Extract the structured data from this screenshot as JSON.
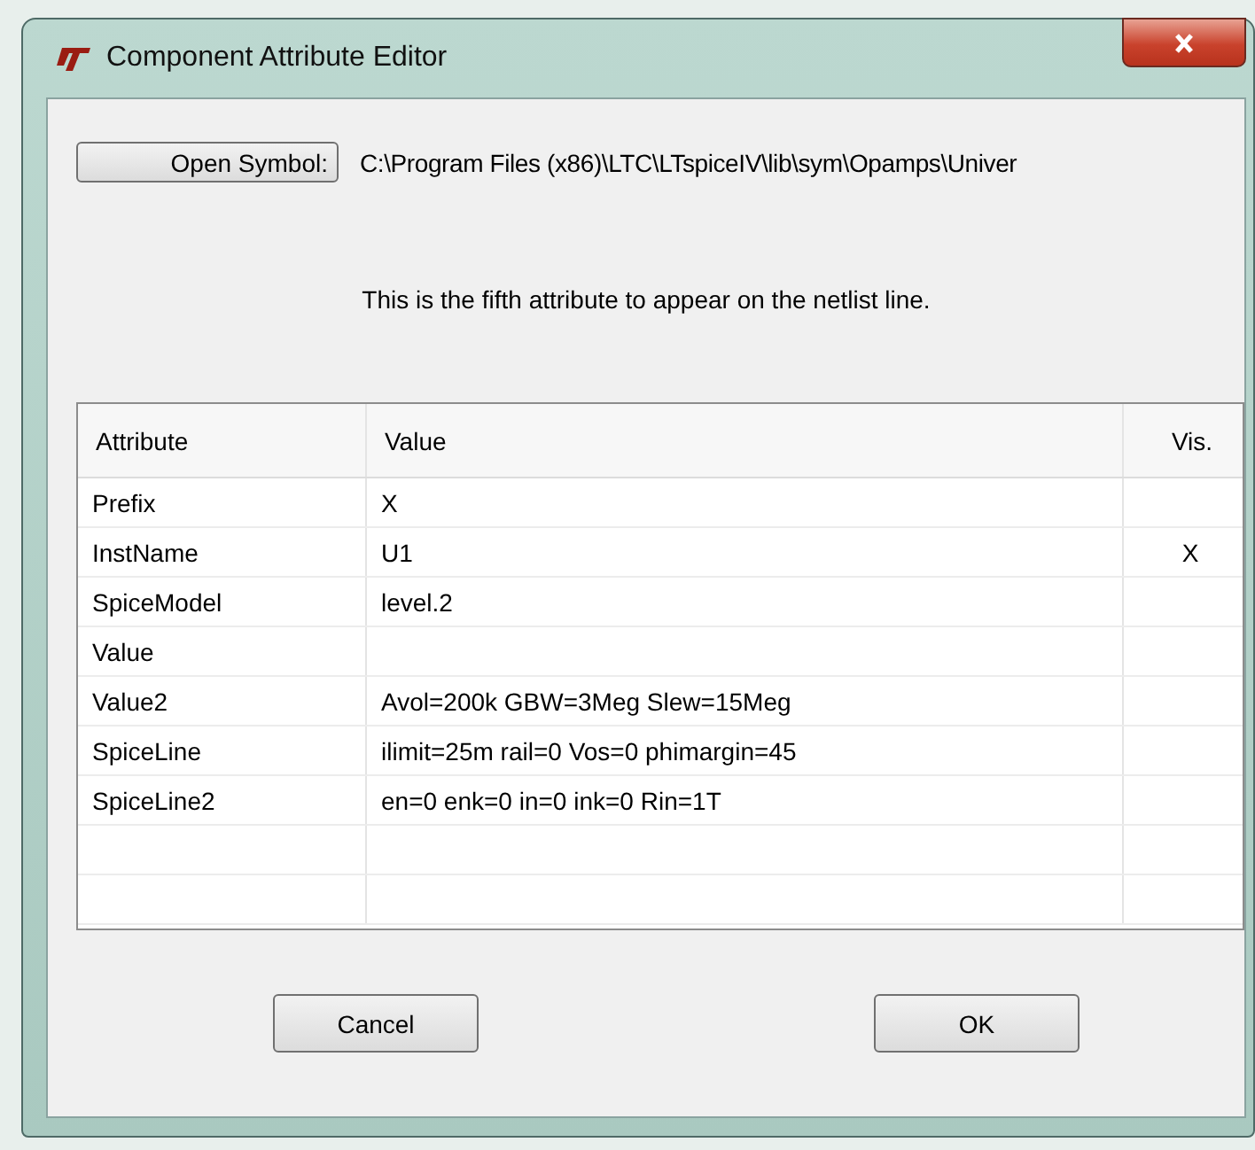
{
  "window": {
    "title": "Component Attribute Editor"
  },
  "open_symbol_button": "Open Symbol:",
  "symbol_path": "C:\\Program Files (x86)\\LTC\\LTspiceIV\\lib\\sym\\Opamps\\Univer",
  "description": "This is the fifth attribute to appear on the netlist line.",
  "table": {
    "columns": [
      "Attribute",
      "Value",
      "Vis."
    ],
    "rows": [
      {
        "attribute": "Prefix",
        "value": "X"
      },
      {
        "attribute": "InstName",
        "value": "U1",
        "vis": "X"
      },
      {
        "attribute": "SpiceModel",
        "value": "level.2"
      },
      {
        "attribute": "Value"
      },
      {
        "attribute": "Value2",
        "value": "Avol=200k GBW=3Meg Slew=15Meg"
      },
      {
        "attribute": "SpiceLine",
        "value": "ilimit=25m rail=0 Vos=0 phimargin=45"
      },
      {
        "attribute": "SpiceLine2",
        "value": "en=0 enk=0 in=0 ink=0 Rin=1T"
      }
    ]
  },
  "buttons": [
    "Cancel",
    "OK"
  ]
}
